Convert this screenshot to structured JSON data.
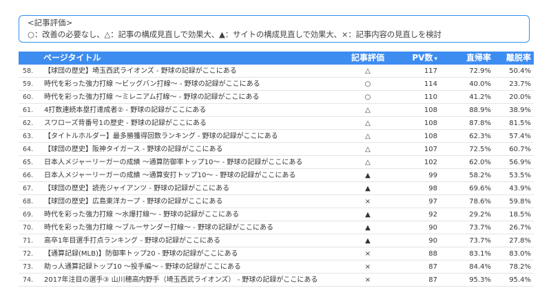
{
  "legend": {
    "title": "<記事評価>",
    "text": "○：改善の必要なし、△：記事の構成見直しで効果大、▲：サイトの構成見直しで効果大、×：記事内容の見直しを検討"
  },
  "table": {
    "headers": {
      "title": "ページタイトル",
      "rating": "記事評価",
      "pv": "PV数",
      "pv_sort_icon": "▾",
      "direct": "直帰率",
      "bounce": "離脱率"
    },
    "rows": [
      {
        "num": "58.",
        "title": "【球団の歴史】埼玉西武ライオンズ - 野球の記録がここにある",
        "rating": "△",
        "pv": "117",
        "direct": "72.9%",
        "bounce": "50.4%"
      },
      {
        "num": "59.",
        "title": "時代を彩った強力打線 ～ビッグバン打線～ - 野球の記録がここにある",
        "rating": "○",
        "pv": "114",
        "direct": "40.0%",
        "bounce": "23.7%"
      },
      {
        "num": "60.",
        "title": "時代を彩った強力打線 ～ミレニアム打線～ - 野球の記録がここにある",
        "rating": "○",
        "pv": "110",
        "direct": "41.2%",
        "bounce": "20.0%"
      },
      {
        "num": "61.",
        "title": "4打数連続本塁打達成者② - 野球の記録がここにある",
        "rating": "△",
        "pv": "108",
        "direct": "88.9%",
        "bounce": "38.9%"
      },
      {
        "num": "62.",
        "title": "スワローズ背番号1の歴史 - 野球の記録がここにある",
        "rating": "△",
        "pv": "108",
        "direct": "87.8%",
        "bounce": "81.5%"
      },
      {
        "num": "63.",
        "title": "【タイトルホルダー】最多勝獲得回数ランキング - 野球の記録がここにある",
        "rating": "△",
        "pv": "108",
        "direct": "62.3%",
        "bounce": "57.4%"
      },
      {
        "num": "64.",
        "title": "【球団の歴史】阪神タイガース - 野球の記録がここにある",
        "rating": "△",
        "pv": "107",
        "direct": "72.5%",
        "bounce": "60.7%"
      },
      {
        "num": "65.",
        "title": "日本人メジャーリーガーの成績 ～通算防御率トップ10～ - 野球の記録がここにある",
        "rating": "△",
        "pv": "102",
        "direct": "62.0%",
        "bounce": "56.9%"
      },
      {
        "num": "66.",
        "title": "日本人メジャーリーガーの成績 ～通算安打トップ10～ - 野球の記録がここにある",
        "rating": "▲",
        "pv": "99",
        "direct": "58.2%",
        "bounce": "53.5%"
      },
      {
        "num": "67.",
        "title": "【球団の歴史】読売ジャイアンツ - 野球の記録がここにある",
        "rating": "▲",
        "pv": "98",
        "direct": "69.6%",
        "bounce": "43.9%"
      },
      {
        "num": "68.",
        "title": "【球団の歴史】広島東洋カープ - 野球の記録がここにある",
        "rating": "×",
        "pv": "97",
        "direct": "78.6%",
        "bounce": "59.8%"
      },
      {
        "num": "69.",
        "title": "時代を彩った強力打線 ～水爆打線～ - 野球の記録がここにある",
        "rating": "▲",
        "pv": "92",
        "direct": "29.2%",
        "bounce": "18.5%"
      },
      {
        "num": "70.",
        "title": "時代を彩った強力打線 ～ブルーサンダー打線～ - 野球の記録がここにある",
        "rating": "▲",
        "pv": "90",
        "direct": "73.7%",
        "bounce": "26.7%"
      },
      {
        "num": "71.",
        "title": "高卒1年目選手打点ランキング - 野球の記録がここにある",
        "rating": "▲",
        "pv": "90",
        "direct": "73.7%",
        "bounce": "27.8%"
      },
      {
        "num": "72.",
        "title": "【通算記録(MLB)】防御率トップ20 - 野球の記録がここにある",
        "rating": "×",
        "pv": "88",
        "direct": "83.1%",
        "bounce": "83.0%"
      },
      {
        "num": "73.",
        "title": "助っ人通算記録トップ10 ～投手編～ - 野球の記録がここにある",
        "rating": "×",
        "pv": "87",
        "direct": "84.4%",
        "bounce": "78.2%"
      },
      {
        "num": "74.",
        "title": "2017年注目の選手③ 山川穂高内野手（埼玉西武ライオンズ） - 野球の記録がここにある",
        "rating": "×",
        "pv": "87",
        "direct": "95.3%",
        "bounce": "95.4%"
      }
    ]
  },
  "colors": {
    "header_bg": "#3d8cf0",
    "legend_border": "#2f8ff0"
  }
}
